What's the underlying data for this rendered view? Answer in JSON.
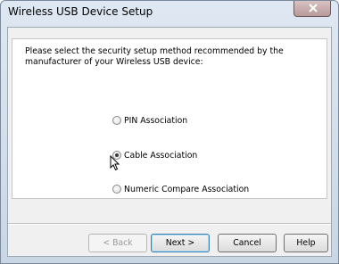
{
  "window": {
    "title": "Wireless USB Device Setup"
  },
  "instruction": "Please select the security setup method recommended by the manufacturer of your Wireless USB device:",
  "options": [
    {
      "label": "PIN Association",
      "checked": false
    },
    {
      "label": "Cable Association",
      "checked": true
    },
    {
      "label": "Numeric Compare Association",
      "checked": false
    }
  ],
  "buttons": {
    "back": "< Back",
    "next": "Next >",
    "cancel": "Cancel",
    "help": "Help"
  }
}
